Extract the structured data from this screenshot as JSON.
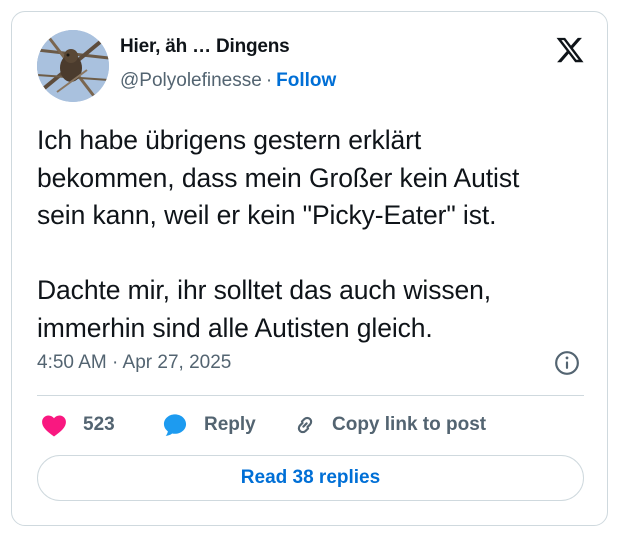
{
  "author": {
    "display_name": "Hier, äh … Dingens",
    "handle": "@Polyolefinesse",
    "separator": "·",
    "follow_label": "Follow"
  },
  "tweet": {
    "text": "Ich habe übrigens gestern erklärt\nbekommen, dass mein Großer kein Autist\nsein kann, weil er kein \"Picky-Eater\" ist.\n\nDachte mir, ihr solltet das auch wissen,\nimmerhin sind alle Autisten gleich.",
    "timestamp": "4:50 AM · Apr 27, 2025"
  },
  "actions": {
    "like_count": "523",
    "reply_label": "Reply",
    "copy_label": "Copy link to post"
  },
  "footer": {
    "read_replies_label": "Read 38 replies"
  },
  "icons": {
    "brand": "x-logo-icon",
    "info": "info-icon",
    "like": "heart-icon",
    "reply": "speech-bubble-icon",
    "copy": "link-icon"
  },
  "colors": {
    "like": "#f91880",
    "reply": "#1d9bf0",
    "link": "#006fd6",
    "muted": "#536471",
    "border": "#cfd9de"
  }
}
